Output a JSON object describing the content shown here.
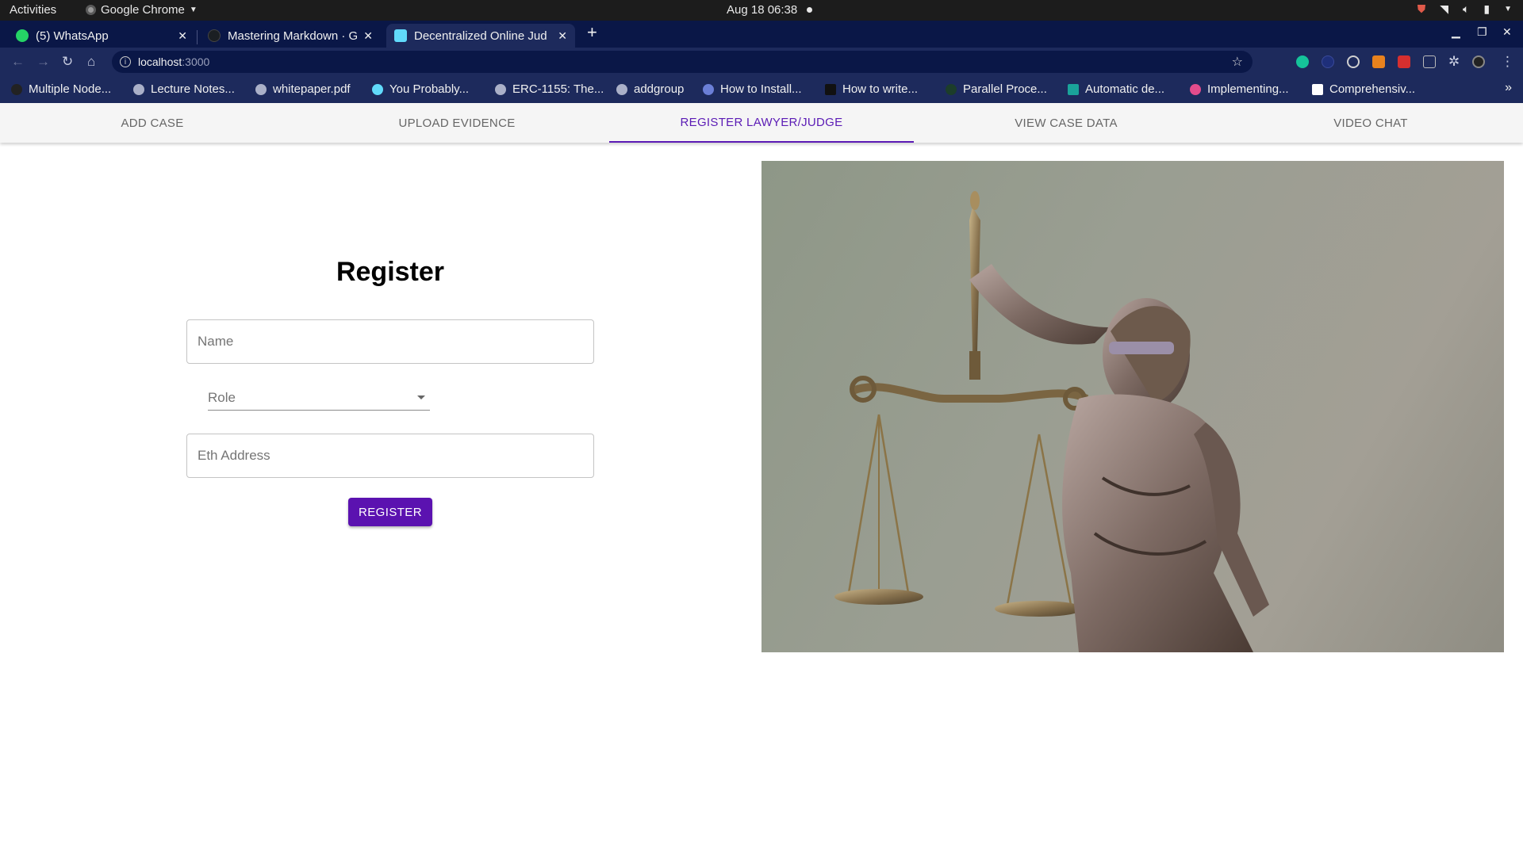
{
  "system": {
    "activities": "Activities",
    "app_name": "Google Chrome",
    "clock": "Aug 18  06:38"
  },
  "browser": {
    "tabs": [
      {
        "title": "(5) WhatsApp",
        "favicon_color": "#25d366"
      },
      {
        "title": "Mastering Markdown · Gi",
        "favicon_color": "#1b1f23"
      },
      {
        "title": "Decentralized Online Jud",
        "favicon_color": "#61dafb"
      }
    ],
    "new_tab": "+",
    "url_host": "localhost",
    "url_port": ":3000",
    "bookmarks": [
      "Multiple Node...",
      "Lecture Notes...",
      "whitepaper.pdf",
      "You Probably...",
      "ERC-1155: The...",
      "addgroup",
      "How to Install...",
      "How to write...",
      "Parallel Proce...",
      "Automatic de...",
      "Implementing...",
      "Comprehensiv..."
    ],
    "bookmarks_more": "»"
  },
  "app": {
    "nav_tabs": [
      "ADD CASE",
      "UPLOAD EVIDENCE",
      "REGISTER LAWYER/JUDGE",
      "VIEW CASE DATA",
      "VIDEO CHAT"
    ],
    "active_tab": "REGISTER LAWYER/JUDGE",
    "accent_color": "#5b12b0",
    "register": {
      "title": "Register",
      "name_placeholder": "Name",
      "role_label": "Role",
      "eth_placeholder": "Eth Address",
      "button_label": "REGISTER"
    },
    "hero_image": "statue-of-lady-justice-with-scales"
  }
}
